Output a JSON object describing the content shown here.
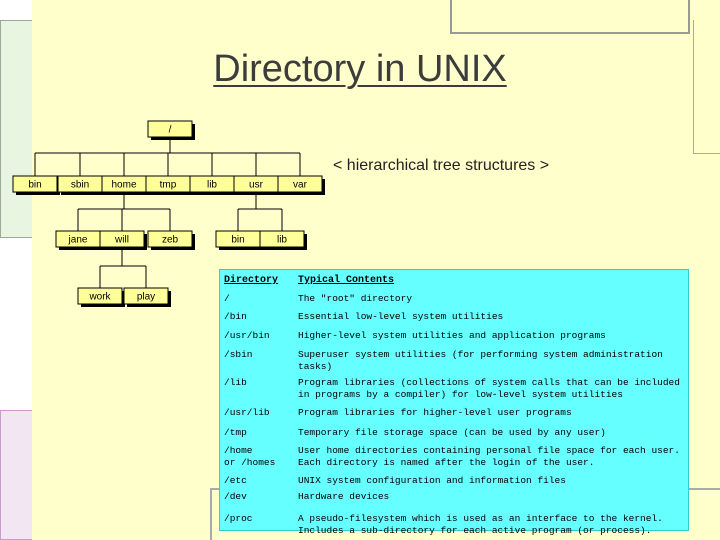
{
  "title": "Directory in UNIX",
  "subtitle": "< hierarchical tree structures >",
  "colors": {
    "slide_bg": "#ffffcc",
    "node_fill": "#ffff99",
    "table_bg": "#66ffff",
    "title_color": "#3c3c3c"
  },
  "tree": {
    "root": {
      "label": "/"
    },
    "level1": [
      "bin",
      "sbin",
      "home",
      "tmp",
      "lib",
      "usr",
      "var"
    ],
    "home_children": [
      "jane",
      "will",
      "zeb"
    ],
    "usr_children": [
      "bin",
      "lib"
    ],
    "will_children": [
      "work",
      "play"
    ]
  },
  "table": {
    "headers": [
      "Directory",
      "Typical Contents"
    ],
    "rows": [
      {
        "dir": "/",
        "desc": "The \"root\" directory"
      },
      {
        "dir": "/bin",
        "desc": "Essential low-level system utilities"
      },
      {
        "dir": "/usr/bin",
        "desc": "Higher-level system utilities and application programs"
      },
      {
        "dir": "/sbin",
        "desc": "Superuser system utilities (for performing system administration\ntasks)"
      },
      {
        "dir": "/lib",
        "desc": "Program libraries (collections of system calls that can be included\nin programs by a compiler) for low-level system utilities"
      },
      {
        "dir": "/usr/lib",
        "desc": "Program libraries for higher-level user programs"
      },
      {
        "dir": "/tmp",
        "desc": "Temporary file storage space (can be used by any user)"
      },
      {
        "dir": "/home\nor /homes",
        "desc": "User home directories containing personal file space for each user.\nEach directory is named after the login of the user."
      },
      {
        "dir": "/etc",
        "desc": "UNIX system configuration and information files"
      },
      {
        "dir": "/dev",
        "desc": "Hardware devices"
      },
      {
        "dir": "/proc",
        "desc": "A pseudo-filesystem which is used as an interface to the kernel.\nIncludes a sub-directory for each active program (or process)."
      }
    ]
  }
}
